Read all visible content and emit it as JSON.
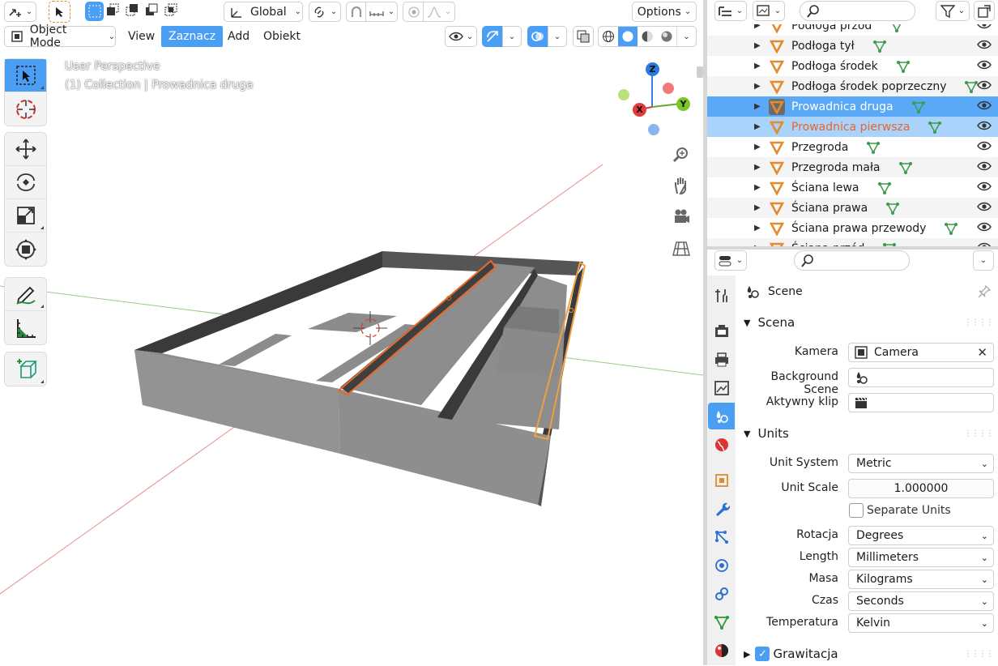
{
  "viewport": {
    "perspective_label": "User Perspective",
    "collection_label": "(1) Collection | Prowadnica druga",
    "transform_orientation": "Global",
    "options_label": "Options",
    "mode_label": "Object Mode",
    "menu": [
      "View",
      "Zaznacz",
      "Add",
      "Obiekt"
    ],
    "menu_active": "Zaznacz",
    "gizmo": {
      "z": "Z",
      "y": "Y",
      "x": "X"
    }
  },
  "outliner": {
    "rows": [
      {
        "name": "Podłoga przód",
        "state": "normal"
      },
      {
        "name": "Podłoga tył",
        "state": "normal"
      },
      {
        "name": "Podłoga środek",
        "state": "normal"
      },
      {
        "name": "Podłoga środek poprzeczny",
        "state": "normal"
      },
      {
        "name": "Prowadnica druga",
        "state": "active"
      },
      {
        "name": "Prowadnica pierwsza",
        "state": "selected"
      },
      {
        "name": "Przegroda",
        "state": "normal"
      },
      {
        "name": "Przegroda mała",
        "state": "normal"
      },
      {
        "name": "Ściana lewa",
        "state": "normal"
      },
      {
        "name": "Ściana prawa",
        "state": "normal"
      },
      {
        "name": "Ściana prawa przewody",
        "state": "normal"
      },
      {
        "name": "Ściana przód",
        "state": "normal"
      }
    ],
    "colors": {
      "active_bg": "#5aa9f7",
      "selected_bg": "#a9d3fb",
      "selected_text": "#e8652a",
      "mesh_orange": "#e68a2e",
      "vert_green": "#3c9a4a"
    }
  },
  "properties": {
    "header": "Scene",
    "scena_section": "Scena",
    "kamera_label": "Kamera",
    "kamera_value": "Camera",
    "bg_scene_label": "Background Scene",
    "active_clip_label": "Aktywny klip",
    "units_section": "Units",
    "unit_system_label": "Unit System",
    "unit_system_value": "Metric",
    "unit_scale_label": "Unit Scale",
    "unit_scale_value": "1.000000",
    "separate_units_label": "Separate Units",
    "rotation_label": "Rotacja",
    "rotation_value": "Degrees",
    "length_label": "Length",
    "length_value": "Millimeters",
    "mass_label": "Masa",
    "mass_value": "Kilograms",
    "time_label": "Czas",
    "time_value": "Seconds",
    "temperature_label": "Temperatura",
    "temperature_value": "Kelvin",
    "gravity_label": "Grawitacja"
  }
}
